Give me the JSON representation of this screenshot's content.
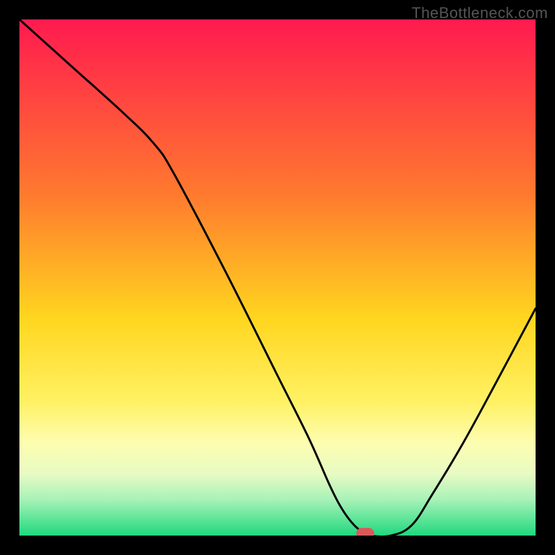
{
  "watermark": "TheBottleneck.com",
  "chart_data": {
    "type": "line",
    "title": "",
    "xlabel": "",
    "ylabel": "",
    "xlim": [
      0,
      100
    ],
    "ylim": [
      0,
      100
    ],
    "x": [
      0,
      10,
      20,
      26,
      30,
      40,
      50,
      56,
      60,
      62,
      64,
      66,
      68,
      72,
      76,
      80,
      86,
      92,
      100
    ],
    "values": [
      100,
      91,
      82,
      76,
      70,
      51,
      31,
      19,
      10,
      6,
      3,
      1,
      0,
      0,
      2,
      8,
      18,
      29,
      44
    ],
    "marker": {
      "x": 67,
      "y": 0.4
    },
    "gradient_stops": [
      {
        "pct": 0,
        "color": "#ff1a4f"
      },
      {
        "pct": 34,
        "color": "#ff7a2e"
      },
      {
        "pct": 58,
        "color": "#ffd61f"
      },
      {
        "pct": 74,
        "color": "#fff163"
      },
      {
        "pct": 82,
        "color": "#fdfdb0"
      },
      {
        "pct": 88,
        "color": "#e8fbc3"
      },
      {
        "pct": 93,
        "color": "#a8f2b7"
      },
      {
        "pct": 100,
        "color": "#1fd97f"
      }
    ],
    "colors": {
      "line": "#000000",
      "marker": "#d95a5a",
      "background": "#000000"
    }
  }
}
